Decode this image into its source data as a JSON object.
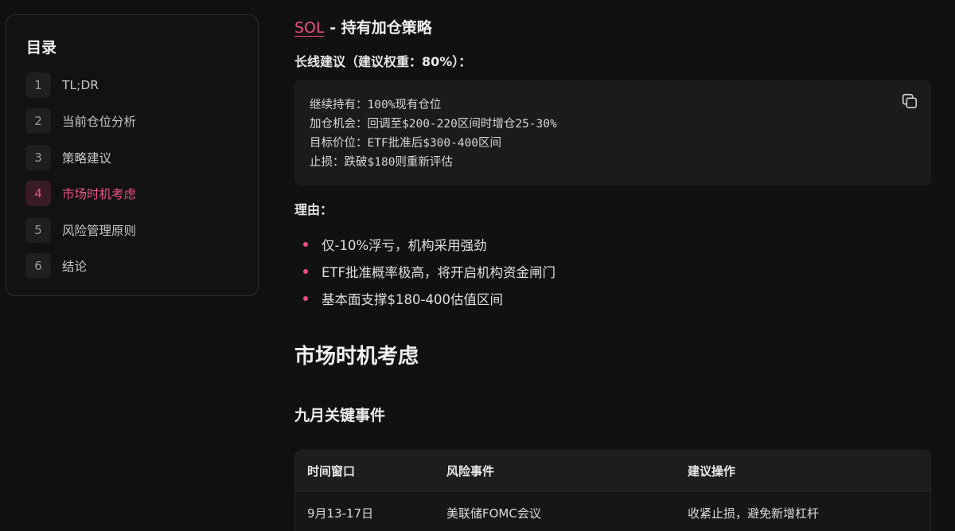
{
  "toc": {
    "title": "目录",
    "items": [
      {
        "num": "1",
        "label": "TL;DR"
      },
      {
        "num": "2",
        "label": "当前仓位分析"
      },
      {
        "num": "3",
        "label": "策略建议"
      },
      {
        "num": "4",
        "label": "市场时机考虑",
        "active": true
      },
      {
        "num": "5",
        "label": "风险管理原则"
      },
      {
        "num": "6",
        "label": "结论"
      }
    ]
  },
  "content": {
    "sol_link": "SOL",
    "sol_heading_rest": " - 持有加仓策略",
    "long_term_heading": "长线建议（建议权重：80%）：",
    "code_lines": [
      "继续持有：100%现有仓位",
      "加仓机会：回调至$200-220区间时增仓25-30%",
      "目标价位：ETF批准后$300-400区间",
      "止损：跌破$180则重新评估"
    ],
    "reason_heading": "理由：",
    "reasons": [
      "仅-10%浮亏，机构采用强劲",
      "ETF批准概率极高，将开启机构资金闸门",
      "基本面支撑$180-400估值区间"
    ],
    "section_heading": "市场时机考虑",
    "subsection_heading": "九月关键事件",
    "table": {
      "headers": [
        "时间窗口",
        "风险事件",
        "建议操作"
      ],
      "rows": [
        [
          "9月13-17日",
          "美联储FOMC会议",
          "收紧止损，避免新增杠杆"
        ]
      ]
    }
  },
  "colors": {
    "accent": "#ec4f86",
    "background": "#111111"
  },
  "icons": {
    "copy": "copy-icon"
  }
}
